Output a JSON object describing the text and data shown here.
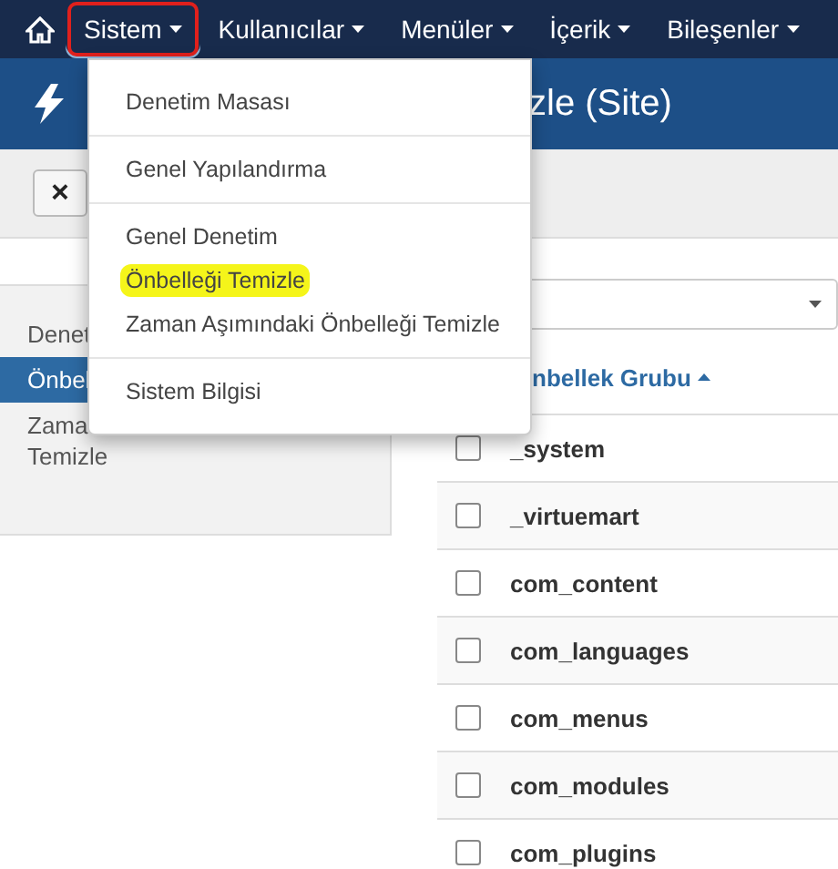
{
  "navbar": {
    "items": [
      {
        "label": "Sistem",
        "open": true,
        "annotated": true
      },
      {
        "label": "Kullanıcılar",
        "open": false,
        "annotated": false
      },
      {
        "label": "Menüler",
        "open": false,
        "annotated": false
      },
      {
        "label": "İçerik",
        "open": false,
        "annotated": false
      },
      {
        "label": "Bileşenler",
        "open": false,
        "annotated": false
      }
    ]
  },
  "dropdown": {
    "groups": [
      [
        {
          "label": "Denetim Masası",
          "highlighted": false
        }
      ],
      [
        {
          "label": "Genel Yapılandırma",
          "highlighted": false
        }
      ],
      [
        {
          "label": "Genel Denetim",
          "highlighted": false
        },
        {
          "label": "Önbelleği Temizle",
          "highlighted": true
        },
        {
          "label": "Zaman Aşımındaki Önbelleği Temizle",
          "highlighted": false
        }
      ],
      [
        {
          "label": "Sistem Bilgisi",
          "highlighted": false
        }
      ]
    ]
  },
  "header": {
    "title": "zle (Site)"
  },
  "toolbar": {
    "close_button": "×"
  },
  "sidebar": {
    "items": [
      {
        "lines": [
          "Denet"
        ],
        "selected": false
      },
      {
        "lines": [
          "Önbel"
        ],
        "selected": true
      },
      {
        "lines": [
          "Zama",
          "Temizle"
        ],
        "selected": false
      }
    ]
  },
  "table": {
    "column": "nbellek Grubu",
    "sort_ascending": true,
    "rows": [
      {
        "name": "_system",
        "checked": false
      },
      {
        "name": "_virtuemart",
        "checked": false
      },
      {
        "name": "com_content",
        "checked": false
      },
      {
        "name": "com_languages",
        "checked": false
      },
      {
        "name": "com_menus",
        "checked": false
      },
      {
        "name": "com_modules",
        "checked": false
      },
      {
        "name": "com_plugins",
        "checked": false
      }
    ]
  }
}
